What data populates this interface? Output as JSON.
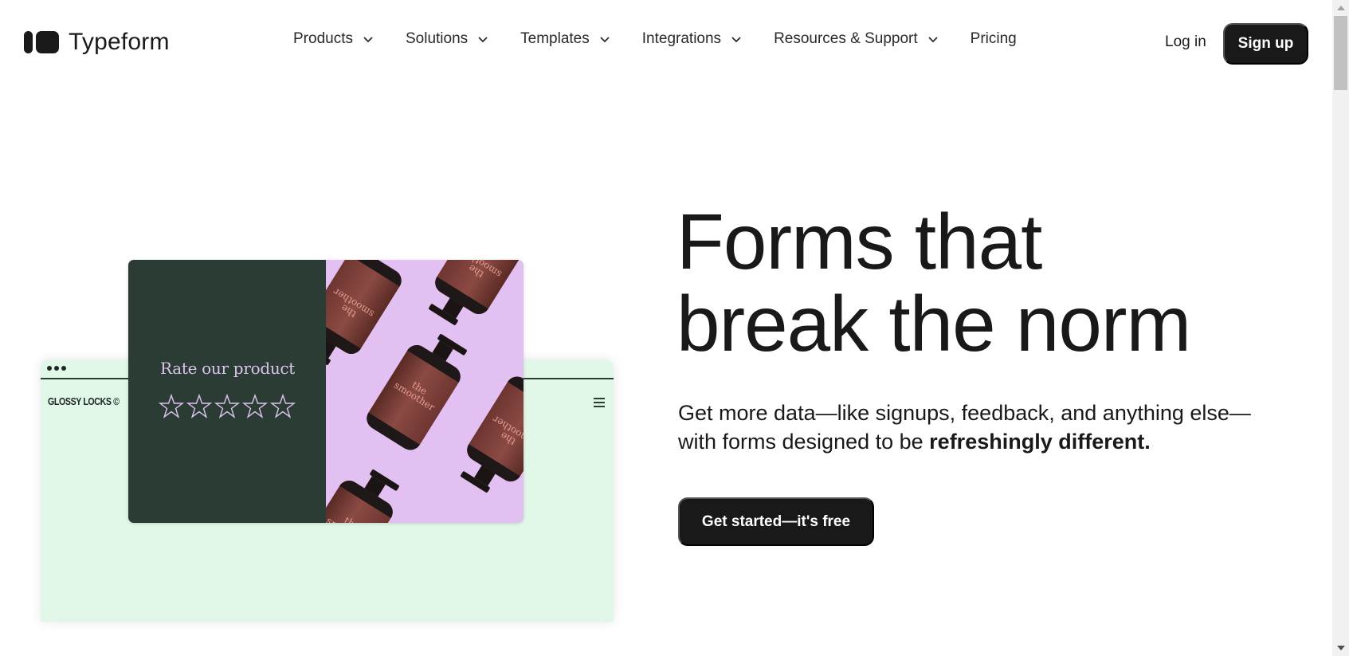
{
  "header": {
    "logo_text": "Typeform",
    "nav": [
      {
        "label": "Products",
        "has_dropdown": true
      },
      {
        "label": "Solutions",
        "has_dropdown": true
      },
      {
        "label": "Templates",
        "has_dropdown": true
      },
      {
        "label": "Integrations",
        "has_dropdown": true
      },
      {
        "label": "Resources & Support",
        "has_dropdown": true
      },
      {
        "label": "Pricing",
        "has_dropdown": false
      }
    ],
    "login_label": "Log in",
    "signup_label": "Sign up"
  },
  "hero": {
    "headline_line1": "Forms that",
    "headline_line2": "break the norm",
    "sub_regular": "Get more data—like signups, feedback, and anything else—with forms designed to be ",
    "sub_bold": "refreshingly different.",
    "cta_label": "Get started—it's free"
  },
  "mockup": {
    "brand": "GLOSSY LOCKS ©",
    "question": "Rate our product",
    "rating_max": 5,
    "rating_value": 0,
    "product_label_line1": "the",
    "product_label_line2": "smoother"
  },
  "colors": {
    "primary_dark": "#191919",
    "mock_panel_bg": "#e1f8e9",
    "card_left_bg": "#2a3c33",
    "card_right_bg": "#e2c0f2",
    "card_text": "#dcc3ec"
  }
}
